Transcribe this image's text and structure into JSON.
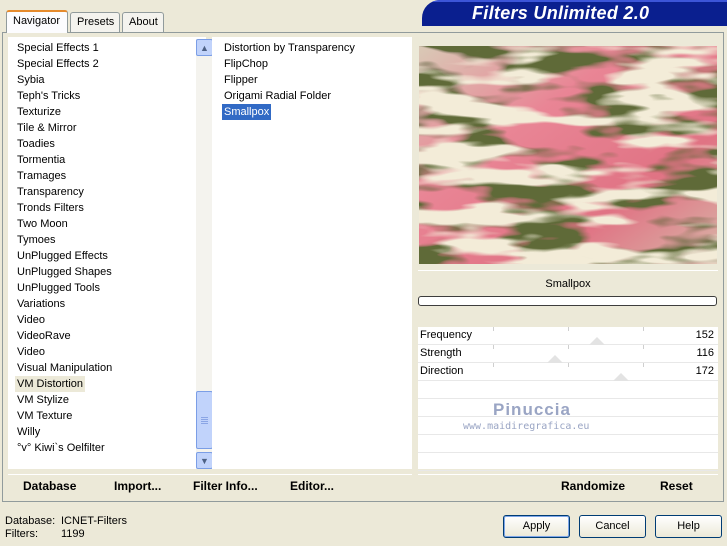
{
  "tabs": [
    "Navigator",
    "Presets",
    "About"
  ],
  "app_title": "Filters Unlimited 2.0",
  "categories": [
    "Special Effects 1",
    "Special Effects 2",
    "Sybia",
    "Teph's Tricks",
    "Texturize",
    "Tile & Mirror",
    "Toadies",
    "Tormentia",
    "Tramages",
    "Transparency",
    "Tronds Filters",
    "Two Moon",
    "Tymoes",
    "UnPlugged Effects",
    "UnPlugged Shapes",
    "UnPlugged Tools",
    "Variations",
    "Video",
    "VideoRave",
    "Video",
    "Visual Manipulation",
    "VM Distortion",
    "VM Stylize",
    "VM Texture",
    "Willy",
    "°v° Kiwi`s Oelfilter"
  ],
  "selected_category": "VM Distortion",
  "filters": [
    "Distortion by Transparency",
    "FlipChop",
    "Flipper",
    "Origami Radial Folder",
    "Smallpox"
  ],
  "selected_filter": "Smallpox",
  "preview": {
    "filter_name": "Smallpox",
    "progress": 0
  },
  "parameters": [
    {
      "label": "Frequency",
      "value": "152",
      "slider": 0.596
    },
    {
      "label": "Strength",
      "value": "116",
      "slider": 0.455
    },
    {
      "label": "Direction",
      "value": "172",
      "slider": 0.675
    }
  ],
  "watermark": {
    "name": "Pinuccia",
    "url": "www.maidiregrafica.eu"
  },
  "toolbar": {
    "database": "Database",
    "import": "Import...",
    "filter_info": "Filter Info...",
    "editor": "Editor...",
    "randomize": "Randomize",
    "reset": "Reset"
  },
  "footer": {
    "database_label": "Database:",
    "database_value": "ICNET-Filters",
    "filters_label": "Filters:",
    "filters_value": "1199"
  },
  "buttons": {
    "apply": "Apply",
    "cancel": "Cancel",
    "help": "Help"
  },
  "colors": {
    "title_bg": "#0a1f8f",
    "selection": "#316ac5",
    "tab_highlight": "#e68b2c"
  }
}
